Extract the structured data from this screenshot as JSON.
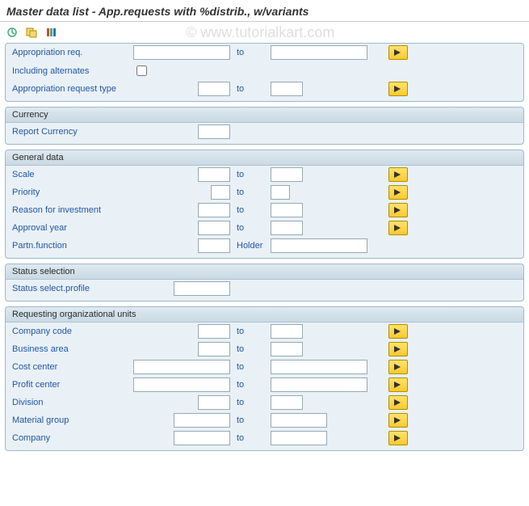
{
  "title": "Master data list - App.requests with %distrib., w/variants",
  "watermark": "© www.tutorialkart.com",
  "top": {
    "approp_req_label": "Appropriation req.",
    "incl_alt_label": "Including alternates",
    "approp_type_label": "Appropriation request type",
    "to_label": "to"
  },
  "currency": {
    "header": "Currency",
    "report_currency_label": "Report Currency"
  },
  "general": {
    "header": "General data",
    "scale_label": "Scale",
    "priority_label": "Priority",
    "reason_label": "Reason for investment",
    "approval_year_label": "Approval year",
    "partn_label": "Partn.function",
    "holder_label": "Holder",
    "to_label": "to"
  },
  "status": {
    "header": "Status selection",
    "profile_label": "Status select.profile"
  },
  "org": {
    "header": "Requesting organizational units",
    "company_code_label": "Company code",
    "business_area_label": "Business area",
    "cost_center_label": "Cost center",
    "profit_center_label": "Profit center",
    "division_label": "Division",
    "material_group_label": "Material group",
    "company_label": "Company",
    "to_label": "to"
  }
}
